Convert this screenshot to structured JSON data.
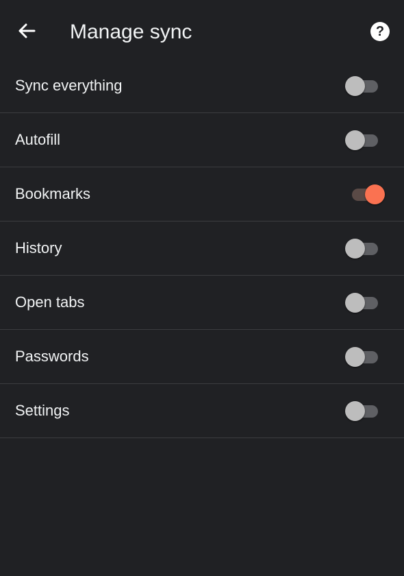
{
  "header": {
    "title": "Manage sync",
    "back_icon": "arrow-left-icon",
    "help_icon": "help-circle-icon",
    "help_glyph": "?"
  },
  "accent_color": "#fa7251",
  "items": [
    {
      "label": "Sync everything",
      "on": false
    },
    {
      "label": "Autofill",
      "on": false
    },
    {
      "label": "Bookmarks",
      "on": true
    },
    {
      "label": "History",
      "on": false
    },
    {
      "label": "Open tabs",
      "on": false
    },
    {
      "label": "Passwords",
      "on": false
    },
    {
      "label": "Settings",
      "on": false
    }
  ]
}
